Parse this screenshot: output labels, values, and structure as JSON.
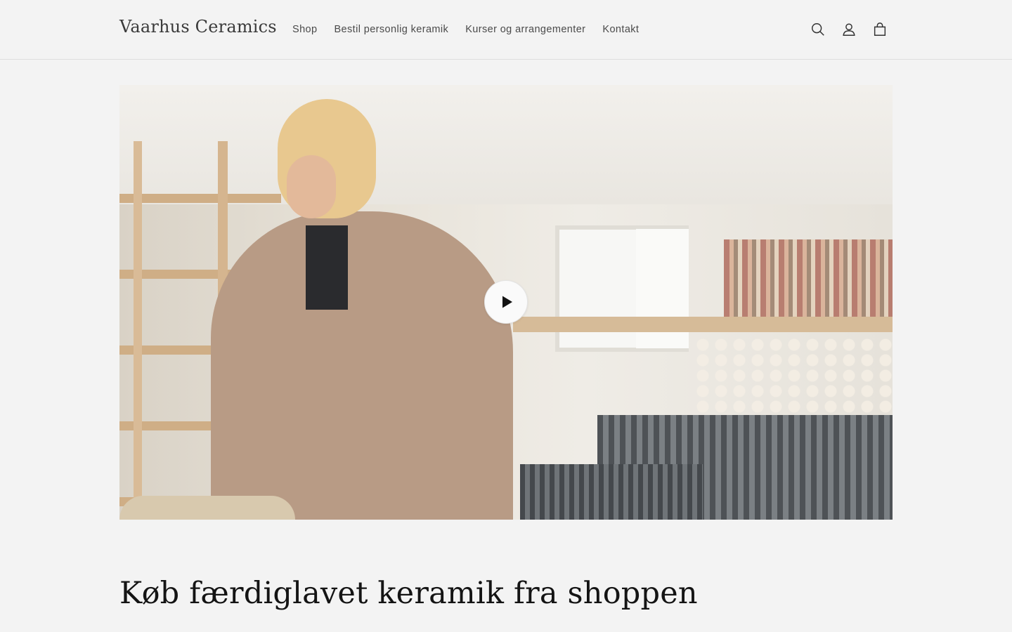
{
  "header": {
    "logo": "Vaarhus Ceramics",
    "nav": [
      {
        "label": "Shop"
      },
      {
        "label": "Bestil personlig keramik"
      },
      {
        "label": "Kurser og arrangementer"
      },
      {
        "label": "Kontakt"
      }
    ],
    "icons": [
      "search-icon",
      "account-icon",
      "cart-icon"
    ]
  },
  "hero_video": {
    "play_icon": "play-icon"
  },
  "main": {
    "section_title": "Køb færdiglavet keramik fra shoppen"
  }
}
